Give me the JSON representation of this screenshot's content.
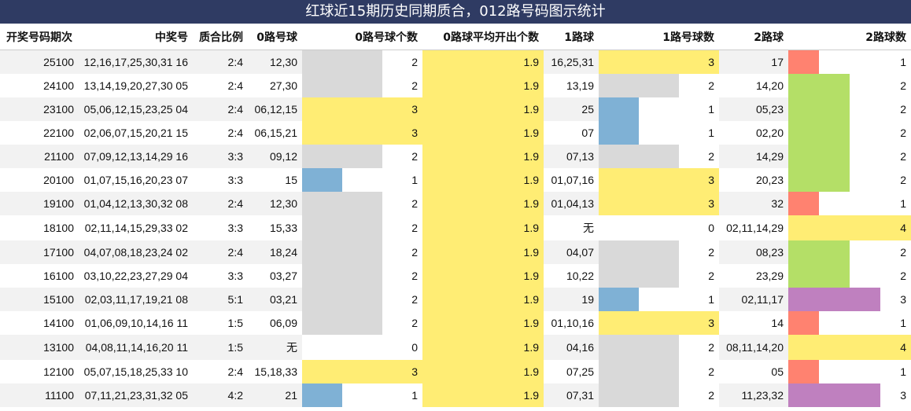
{
  "title": "红球近15期历史同期质合，012路号码图示统计",
  "colors": {
    "v0": "#ffffff",
    "v1": "#7fb1d5",
    "v2": "#d9d9d9",
    "v3": "#ffed74",
    "v4": "#ffed74",
    "r1": "#ff8270",
    "r2": "#b4df67",
    "r3": "#bf80bf",
    "r4": "#ffed74",
    "avg": "#ffed74"
  },
  "headers": [
    "开奖号码期次",
    "中奖号",
    "质合比例",
    "0路号球",
    "0路号球个数",
    "0路球平均开出个数",
    "1路球",
    "1路号球数",
    "2路球",
    "2路球数"
  ],
  "rows": [
    {
      "period": "25100",
      "numbers": "12,16,17,25,30,31 16",
      "ratio": "2:4",
      "r0": "12,30",
      "c0": 2,
      "avg": "1.9",
      "r1": "16,25,31",
      "c1": 3,
      "r2": "17",
      "c2": 1
    },
    {
      "period": "24100",
      "numbers": "13,14,19,20,27,30 05",
      "ratio": "2:4",
      "r0": "27,30",
      "c0": 2,
      "avg": "1.9",
      "r1": "13,19",
      "c1": 2,
      "r2": "14,20",
      "c2": 2
    },
    {
      "period": "23100",
      "numbers": "05,06,12,15,23,25 04",
      "ratio": "2:4",
      "r0": "06,12,15",
      "c0": 3,
      "avg": "1.9",
      "r1": "25",
      "c1": 1,
      "r2": "05,23",
      "c2": 2
    },
    {
      "period": "22100",
      "numbers": "02,06,07,15,20,21 15",
      "ratio": "2:4",
      "r0": "06,15,21",
      "c0": 3,
      "avg": "1.9",
      "r1": "07",
      "c1": 1,
      "r2": "02,20",
      "c2": 2
    },
    {
      "period": "21100",
      "numbers": "07,09,12,13,14,29 16",
      "ratio": "3:3",
      "r0": "09,12",
      "c0": 2,
      "avg": "1.9",
      "r1": "07,13",
      "c1": 2,
      "r2": "14,29",
      "c2": 2
    },
    {
      "period": "20100",
      "numbers": "01,07,15,16,20,23 07",
      "ratio": "3:3",
      "r0": "15",
      "c0": 1,
      "avg": "1.9",
      "r1": "01,07,16",
      "c1": 3,
      "r2": "20,23",
      "c2": 2
    },
    {
      "period": "19100",
      "numbers": "01,04,12,13,30,32 08",
      "ratio": "2:4",
      "r0": "12,30",
      "c0": 2,
      "avg": "1.9",
      "r1": "01,04,13",
      "c1": 3,
      "r2": "32",
      "c2": 1
    },
    {
      "period": "18100",
      "numbers": "02,11,14,15,29,33 02",
      "ratio": "3:3",
      "r0": "15,33",
      "c0": 2,
      "avg": "1.9",
      "r1": "无",
      "c1": 0,
      "r2": "02,11,14,29",
      "c2": 4
    },
    {
      "period": "17100",
      "numbers": "04,07,08,18,23,24 02",
      "ratio": "2:4",
      "r0": "18,24",
      "c0": 2,
      "avg": "1.9",
      "r1": "04,07",
      "c1": 2,
      "r2": "08,23",
      "c2": 2
    },
    {
      "period": "16100",
      "numbers": "03,10,22,23,27,29 04",
      "ratio": "3:3",
      "r0": "03,27",
      "c0": 2,
      "avg": "1.9",
      "r1": "10,22",
      "c1": 2,
      "r2": "23,29",
      "c2": 2
    },
    {
      "period": "15100",
      "numbers": "02,03,11,17,19,21 08",
      "ratio": "5:1",
      "r0": "03,21",
      "c0": 2,
      "avg": "1.9",
      "r1": "19",
      "c1": 1,
      "r2": "02,11,17",
      "c2": 3
    },
    {
      "period": "14100",
      "numbers": "01,06,09,10,14,16 11",
      "ratio": "1:5",
      "r0": "06,09",
      "c0": 2,
      "avg": "1.9",
      "r1": "01,10,16",
      "c1": 3,
      "r2": "14",
      "c2": 1
    },
    {
      "period": "13100",
      "numbers": "04,08,11,14,16,20 11",
      "ratio": "1:5",
      "r0": "无",
      "c0": 0,
      "avg": "1.9",
      "r1": "04,16",
      "c1": 2,
      "r2": "08,11,14,20",
      "c2": 4
    },
    {
      "period": "12100",
      "numbers": "05,07,15,18,25,33 10",
      "ratio": "2:4",
      "r0": "15,18,33",
      "c0": 3,
      "avg": "1.9",
      "r1": "07,25",
      "c1": 2,
      "r2": "05",
      "c2": 1
    },
    {
      "period": "11100",
      "numbers": "07,11,21,23,31,32 05",
      "ratio": "4:2",
      "r0": "21",
      "c0": 1,
      "avg": "1.9",
      "r1": "07,31",
      "c1": 2,
      "r2": "11,23,32",
      "c2": 3
    }
  ]
}
